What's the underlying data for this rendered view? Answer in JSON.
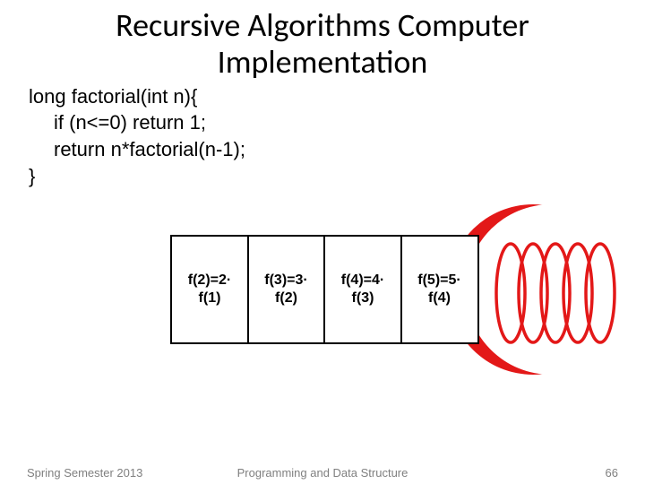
{
  "title_line1": "Recursive Algorithms Computer",
  "title_line2": "Implementation",
  "code": {
    "l1": "long factorial(int n){",
    "l2": "if (n<=0) return 1;",
    "l3": "return n*factorial(n-1);",
    "l4": "}"
  },
  "boxes": [
    {
      "top": "f(2)=2·",
      "bottom": "f(1)"
    },
    {
      "top": "f(3)=3·",
      "bottom": "f(2)"
    },
    {
      "top": "f(4)=4·",
      "bottom": "f(3)"
    },
    {
      "top": "f(5)=5·",
      "bottom": "f(4)"
    }
  ],
  "footer": {
    "left": "Spring Semester 2013",
    "center": "Programming and Data Structure",
    "right": "66"
  }
}
